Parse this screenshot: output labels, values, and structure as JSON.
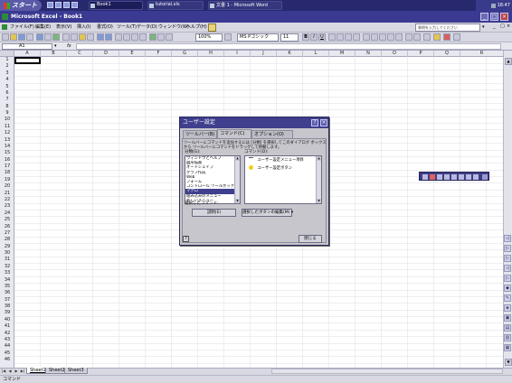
{
  "taskbar": {
    "start_label": "スタート",
    "tasks": [
      {
        "label": "Book1"
      },
      {
        "label": "tutorial.xls"
      },
      {
        "label": "文書 1 - Microsoft Word"
      }
    ],
    "clock": "18:47"
  },
  "window": {
    "title": "Microsoft Excel - Book1"
  },
  "menubar": {
    "items": [
      "ファイル(F)",
      "編集(E)",
      "表示(V)",
      "挿入(I)",
      "書式(O)",
      "ツール(T)",
      "データ(D)",
      "ウィンドウ(W)",
      "ヘルプ(H)"
    ],
    "help_placeholder": "質問を入力してください"
  },
  "toolbar": {
    "zoom": "100%",
    "font_name": "MS Pゴシック",
    "font_size": "11"
  },
  "formula_bar": {
    "name_box": "A1",
    "fx": "fx"
  },
  "grid": {
    "columns": [
      "A",
      "B",
      "C",
      "D",
      "E",
      "F",
      "G",
      "H",
      "I",
      "J",
      "K",
      "L",
      "M",
      "N",
      "O",
      "P",
      "Q",
      "R"
    ],
    "rows": [
      "1",
      "2",
      "3",
      "4",
      "5",
      "6",
      "7",
      "8",
      "9",
      "10",
      "11",
      "12",
      "13",
      "14",
      "15",
      "16",
      "17",
      "18",
      "19",
      "20",
      "21",
      "22",
      "23",
      "24",
      "25",
      "26",
      "27",
      "28",
      "29",
      "30",
      "31",
      "32",
      "33",
      "34",
      "35",
      "36",
      "37",
      "38",
      "39",
      "40",
      "41",
      "42",
      "43",
      "44",
      "45",
      "46"
    ]
  },
  "sheets": {
    "tabs": [
      "Sheet1",
      "Sheet2",
      "Sheet3"
    ],
    "active": "Sheet1"
  },
  "status": {
    "text": "コマンド"
  },
  "dialog": {
    "title": "ユーザー設定",
    "tabs": [
      "ツールバー(B)",
      "コマンド(C)",
      "オプション(O)"
    ],
    "active_tab": "コマンド(C)",
    "description": "ツールバーにコマンドを追加するには [分類] を選択してこのダイアログ ボックスから ツールバーにコマンドをドラッグして移動します。",
    "category_label": "分類(G):",
    "categories": [
      "ウィンドウとヘルプ",
      "図形描画",
      "オートシェイプ",
      "グラフ作成",
      "Web",
      "フォーム",
      "コントロール ツールボックス",
      "マクロ",
      "組み込みのメニュー",
      "新しいメニュー"
    ],
    "selected_category": "マクロ",
    "commands_label": "コマンド(D):",
    "commands": [
      {
        "label": "ユーザー設定メニュー項目",
        "icon": "menu-item-icon"
      },
      {
        "label": "ユーザー設定ボタン",
        "icon": "smiley-icon"
      }
    ],
    "selected_command_label": "選択したコマンド:",
    "describe_button": "説明(E)",
    "modify_selection_button": "選択したボタンの編集(M) ▾",
    "close_button": "閉じる"
  },
  "colors": {
    "title_bar": "#3a3a92",
    "taskbar": "#28286e",
    "dialog_title": "#3f3f8e"
  }
}
